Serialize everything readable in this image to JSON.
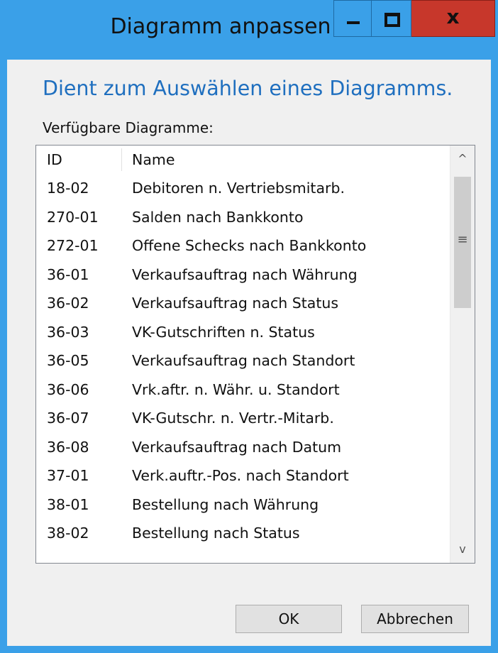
{
  "window": {
    "title": "Diagramm anpassen",
    "controls": {
      "minimize_icon": "minimize-icon",
      "maximize_icon": "maximize-icon",
      "close_label": "x"
    }
  },
  "dialog": {
    "heading": "Dient zum Auswählen eines Diagramms.",
    "available_label": "Verfügbare Diagramme:"
  },
  "table": {
    "columns": [
      "ID",
      "Name"
    ],
    "rows": [
      {
        "id": "18-02",
        "name": "Debitoren n. Vertriebsmitarb."
      },
      {
        "id": "270-01",
        "name": "Salden nach Bankkonto"
      },
      {
        "id": "272-01",
        "name": "Offene Schecks nach Bankkonto"
      },
      {
        "id": "36-01",
        "name": "Verkaufsauftrag nach Währung"
      },
      {
        "id": "36-02",
        "name": "Verkaufsauftrag nach Status"
      },
      {
        "id": "36-03",
        "name": "VK-Gutschriften n. Status"
      },
      {
        "id": "36-05",
        "name": "Verkaufsauftrag nach Standort"
      },
      {
        "id": "36-06",
        "name": "Vrk.aftr. n. Währ. u. Standort"
      },
      {
        "id": "36-07",
        "name": "VK-Gutschr. n. Vertr.-Mitarb."
      },
      {
        "id": "36-08",
        "name": "Verkaufsauftrag nach Datum"
      },
      {
        "id": "37-01",
        "name": "Verk.auftr.-Pos. nach Standort"
      },
      {
        "id": "38-01",
        "name": "Bestellung nach Währung"
      },
      {
        "id": "38-02",
        "name": "Bestellung nach Status"
      }
    ]
  },
  "scrollbar": {
    "up_glyph": "^",
    "down_glyph": "v",
    "grip_glyph": "≡"
  },
  "buttons": {
    "ok": "OK",
    "cancel": "Abbrechen"
  },
  "colors": {
    "frame": "#3aa0e8",
    "heading": "#1f6fbf",
    "close": "#c7372b"
  }
}
